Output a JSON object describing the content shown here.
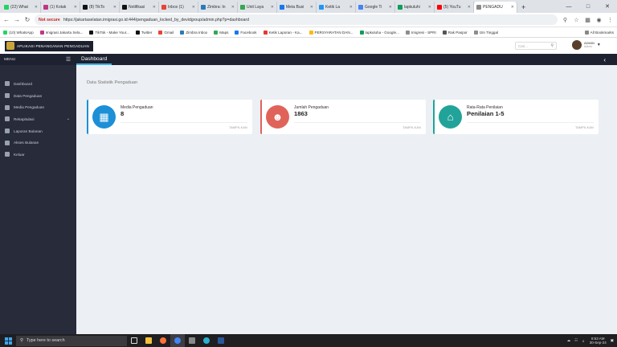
{
  "browser": {
    "tabs": [
      {
        "label": "(22) What",
        "color": "#25d366"
      },
      {
        "label": "(1) Kotak",
        "color": "#c13584"
      },
      {
        "label": "(8) TikTo",
        "color": "#111111"
      },
      {
        "label": "Notifikasi",
        "color": "#111111"
      },
      {
        "label": "Inbox (1)",
        "color": "#ea4335"
      },
      {
        "label": "Zimbra: In",
        "color": "#2a7ab8"
      },
      {
        "label": "Unit Laya",
        "color": "#34a853"
      },
      {
        "label": "Meta Busi",
        "color": "#1877f2"
      },
      {
        "label": "Ketik La",
        "color": "#2196f3"
      },
      {
        "label": "Google Ti",
        "color": "#4285f4"
      },
      {
        "label": "lapkuluhi",
        "color": "#0f9d58"
      },
      {
        "label": "(5) YouTu",
        "color": "#ff0000"
      }
    ],
    "active_tab": {
      "label": "PENGADU",
      "color": "#888888"
    },
    "url": "https://jakartaselatan.imigrasi.go.id:444/pengaduan_locked_by_devidgroup/admin.php?p=dashboard",
    "not_secure": "Not secure",
    "bookmarks": [
      {
        "label": "(10) WhatsApp",
        "color": "#25d366"
      },
      {
        "label": "Imigrasi Jakarta Sela...",
        "color": "#c13584"
      },
      {
        "label": "TikTok - Make Your...",
        "color": "#111111"
      },
      {
        "label": "Twitter",
        "color": "#111111"
      },
      {
        "label": "Gmail",
        "color": "#ea4335"
      },
      {
        "label": "Zimbra Inbox",
        "color": "#2a7ab8"
      },
      {
        "label": "Maps",
        "color": "#34a853"
      },
      {
        "label": "Facebook",
        "color": "#1877f2"
      },
      {
        "label": "Ketik Laporan - Ka...",
        "color": "#e53935"
      },
      {
        "label": "PERSYARATAN DAN...",
        "color": "#fbbc05"
      },
      {
        "label": "lapkuluha - Google...",
        "color": "#0f9d58"
      },
      {
        "label": "Imigresi - SPRI",
        "color": "#8d8d8d"
      },
      {
        "label": "Rak Paspor",
        "color": "#555555"
      },
      {
        "label": "Izin Tinggal",
        "color": "#8d8d8d"
      }
    ],
    "all_bookmarks": "All Bookmarks"
  },
  "app": {
    "title": "APLIKASI PENANGANAN PENGADUAN",
    "search_placeholder": "Cari...",
    "user_name": "ADMIN",
    "user_role": "Admin",
    "menu_label": "MENU",
    "page_tab": "Dashboard",
    "sidebar": [
      {
        "label": "Dashboard"
      },
      {
        "label": "Data Pengaduan"
      },
      {
        "label": "Media Pengaduan"
      },
      {
        "label": "Rekapitulasi",
        "has_submenu": true
      },
      {
        "label": "Laporan Bulanan"
      },
      {
        "label": "Akses Bulanan"
      },
      {
        "label": "Keluar"
      }
    ],
    "section_title": "Data Statistik Pengaduan",
    "cards": [
      {
        "label": "Media Pengaduan",
        "value": "8",
        "more": "TAMPILKAN",
        "accent": "#1c8fd6",
        "icon": "building-icon"
      },
      {
        "label": "Jumlah Pengaduan",
        "value": "1863",
        "more": "TAMPILKAN",
        "accent": "#e0635a",
        "icon": "users-icon"
      },
      {
        "label": "Rata-Rata Penilaian",
        "value": "Penilaian 1-5",
        "more": "TAMPILKAN",
        "accent": "#22a39a",
        "icon": "home-icon"
      }
    ]
  },
  "taskbar": {
    "search_placeholder": "Type here to search",
    "time": "8:53 AM",
    "date": "30-Sep-24"
  }
}
